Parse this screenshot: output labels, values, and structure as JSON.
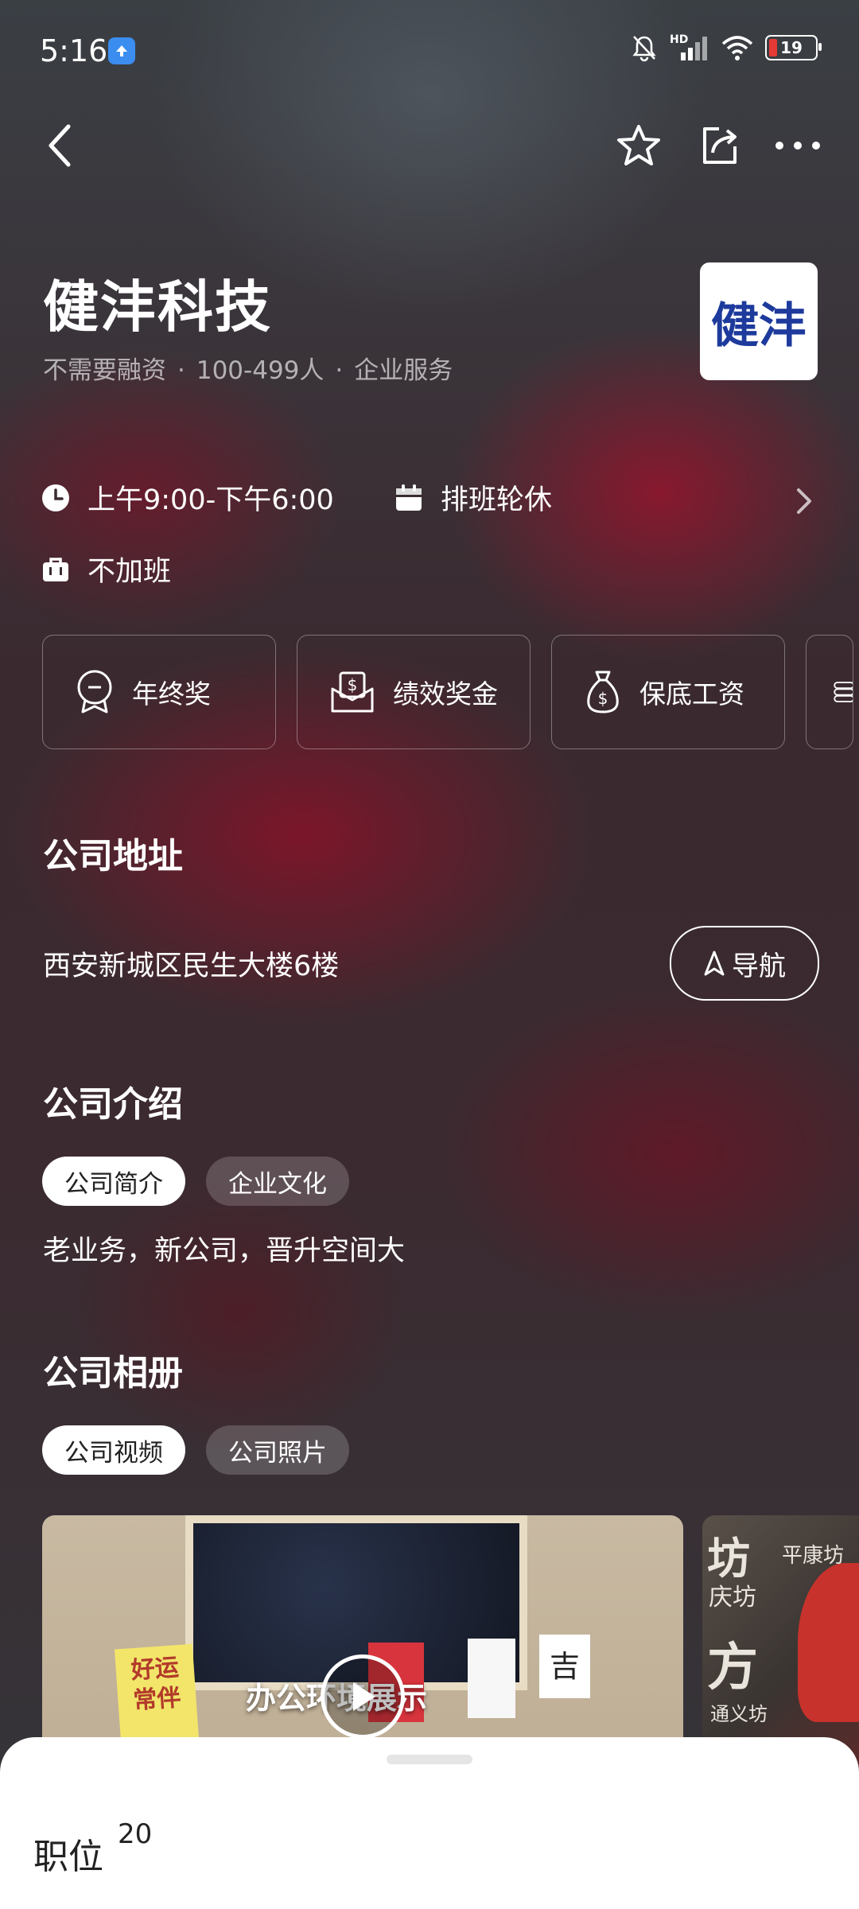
{
  "status_bar": {
    "time": "5:16",
    "signal_label": "HD",
    "battery": "19"
  },
  "company": {
    "name": "健沣科技",
    "funding": "不需要融资",
    "size": "100-499人",
    "industry": "企业服务",
    "logo_text": "健沣"
  },
  "work_info": {
    "hours": "上午9:00-下午6:00",
    "schedule": "排班轮休",
    "overtime": "不加班"
  },
  "benefits": [
    "年终奖",
    "绩效奖金",
    "保底工资"
  ],
  "address": {
    "title": "公司地址",
    "text": "西安新城区民生大楼6楼",
    "nav_label": "导航"
  },
  "intro": {
    "title": "公司介绍",
    "tabs": [
      "公司简介",
      "企业文化"
    ],
    "text": "老业务，新公司，晋升空间大"
  },
  "album": {
    "title": "公司相册",
    "tabs": [
      "公司视频",
      "公司照片"
    ],
    "video_caption": "办公环境展示",
    "card_left": "好运\n常伴",
    "card_right": "吉",
    "photo_words": [
      "坊",
      "庆坊",
      "平康坊",
      "方",
      "通义坊"
    ]
  },
  "bottom_sheet": {
    "label": "职位",
    "count": "20"
  },
  "colors": {
    "accent_red": "#8e1530",
    "logo_blue": "#1d3a9c"
  }
}
